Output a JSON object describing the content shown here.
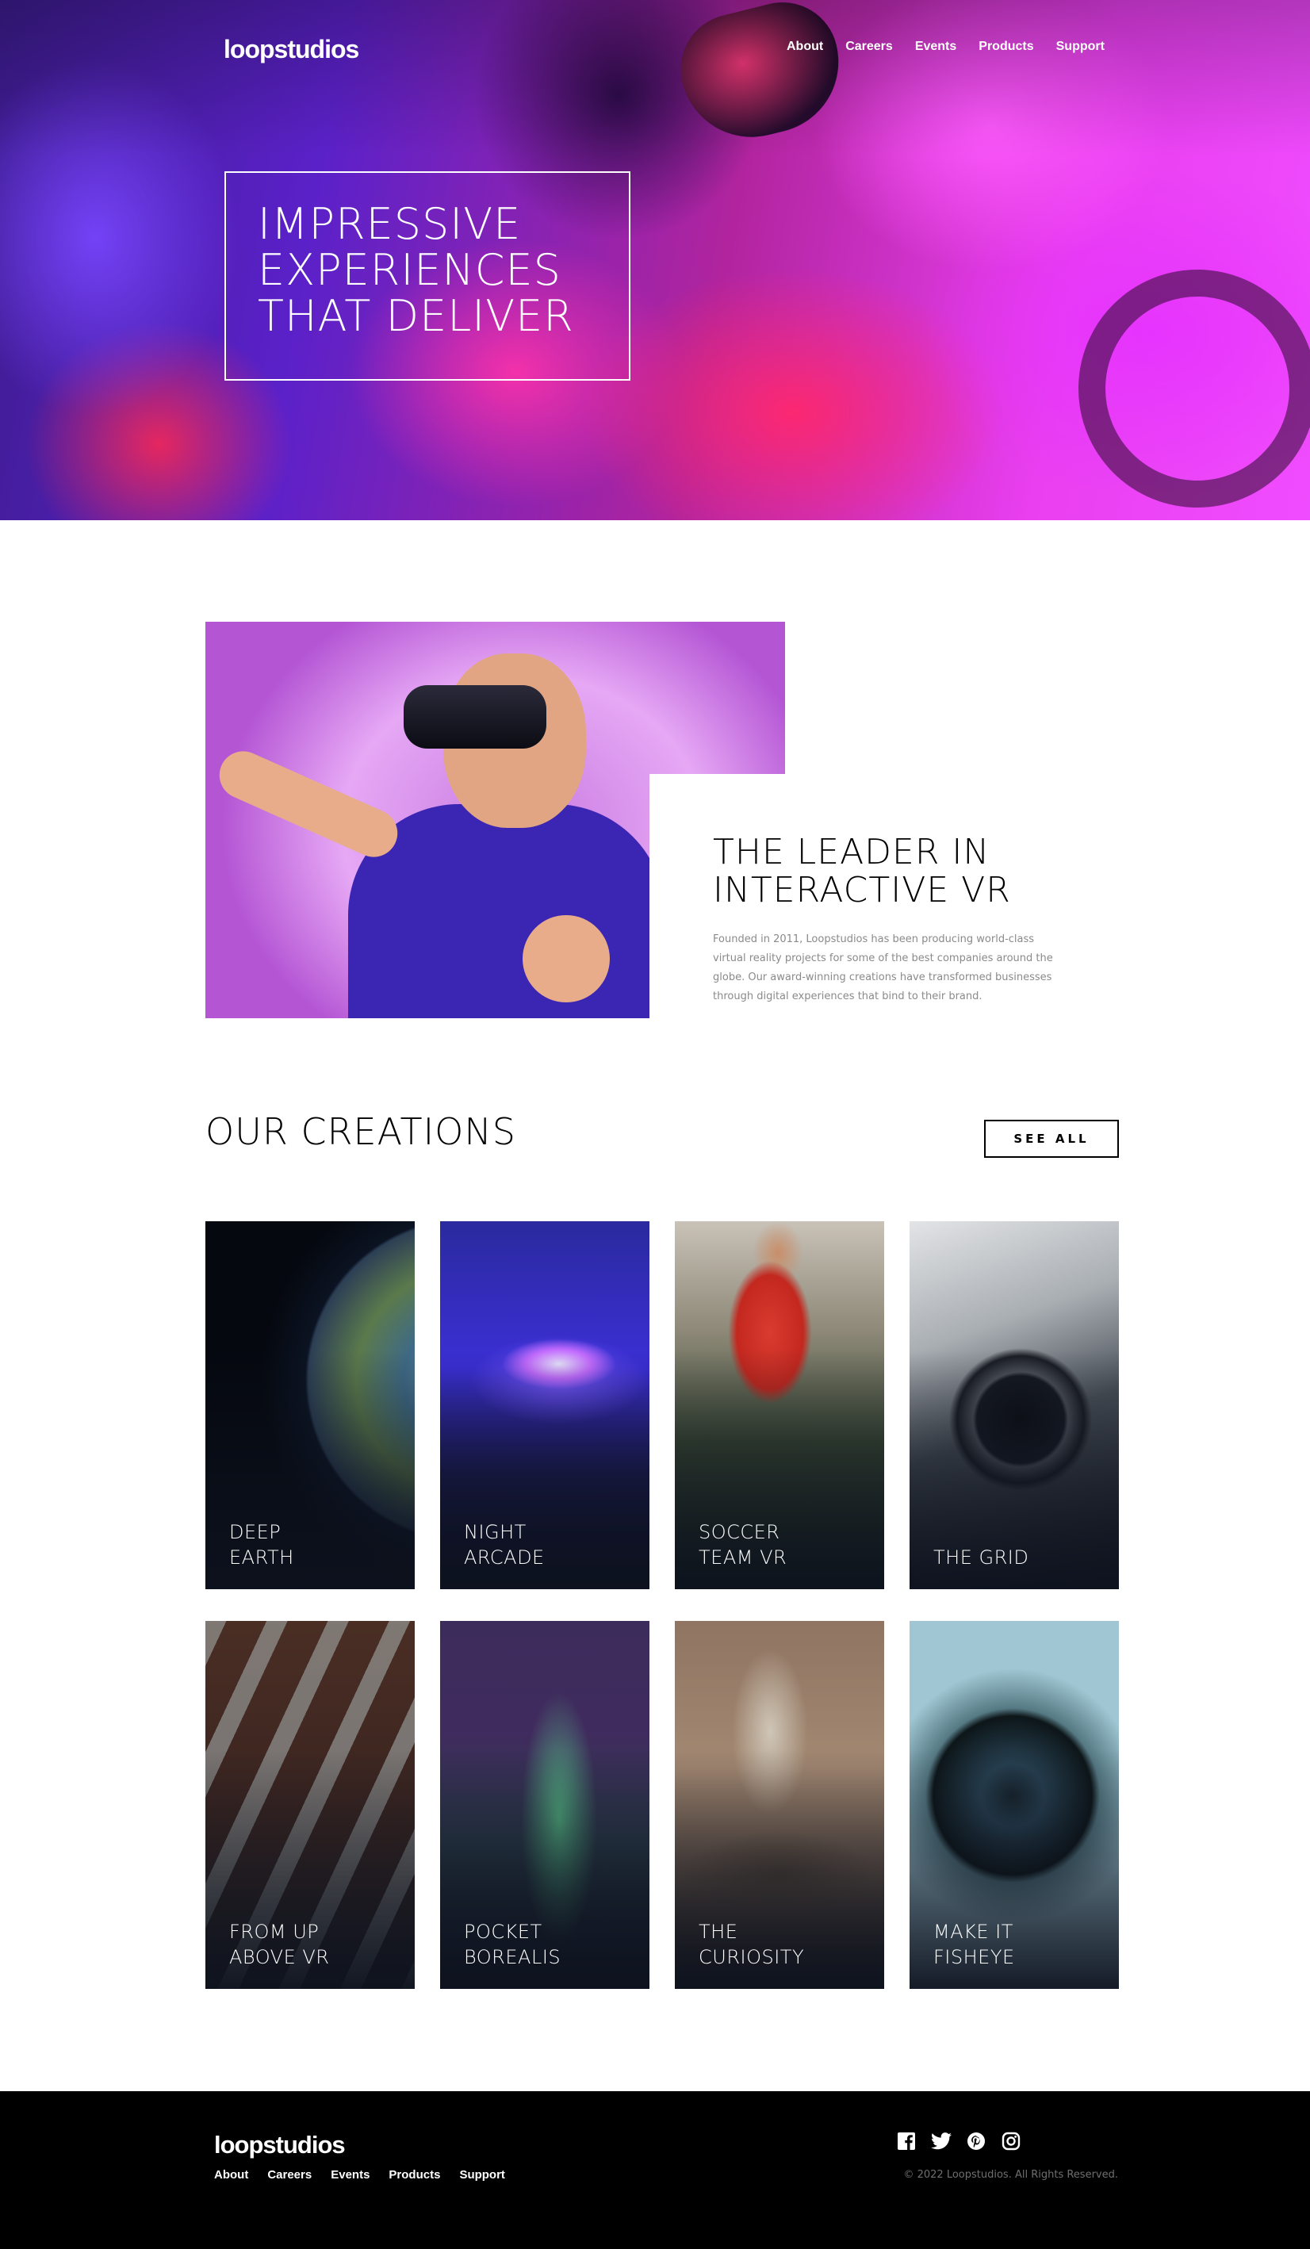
{
  "header": {
    "logo": "loopstudios",
    "nav": [
      "About",
      "Careers",
      "Events",
      "Products",
      "Support"
    ]
  },
  "hero": {
    "title_lines": [
      "IMPRESSIVE",
      "EXPERIENCES",
      "THAT DELIVER"
    ]
  },
  "intro": {
    "title_lines": [
      "THE LEADER IN",
      "INTERACTIVE VR"
    ],
    "text": "Founded in 2011, Loopstudios has been producing world-class virtual reality projects for some of the best companies around the globe. Our award-winning creations have transformed businesses through digital experiences that bind to their brand."
  },
  "creations": {
    "title": "OUR CREATIONS",
    "see_all": "SEE ALL",
    "items": [
      {
        "lines": [
          "DEEP",
          "EARTH"
        ]
      },
      {
        "lines": [
          "NIGHT",
          "ARCADE"
        ]
      },
      {
        "lines": [
          "SOCCER",
          "TEAM VR"
        ]
      },
      {
        "lines": [
          "THE GRID"
        ]
      },
      {
        "lines": [
          "FROM UP",
          "ABOVE VR"
        ]
      },
      {
        "lines": [
          "POCKET",
          "BOREALIS"
        ]
      },
      {
        "lines": [
          "THE",
          "CURIOSITY"
        ]
      },
      {
        "lines": [
          "MAKE IT",
          "FISHEYE"
        ]
      }
    ]
  },
  "footer": {
    "logo": "loopstudios",
    "nav": [
      "About",
      "Careers",
      "Events",
      "Products",
      "Support"
    ],
    "socials": [
      "facebook-icon",
      "twitter-icon",
      "pinterest-icon",
      "instagram-icon"
    ],
    "copyright": "© 2022 Loopstudios. All Rights Reserved."
  },
  "colors": {
    "black": "#000000",
    "white": "#ffffff",
    "gray_text": "#8a8a8a",
    "footer_bg": "#000000"
  }
}
